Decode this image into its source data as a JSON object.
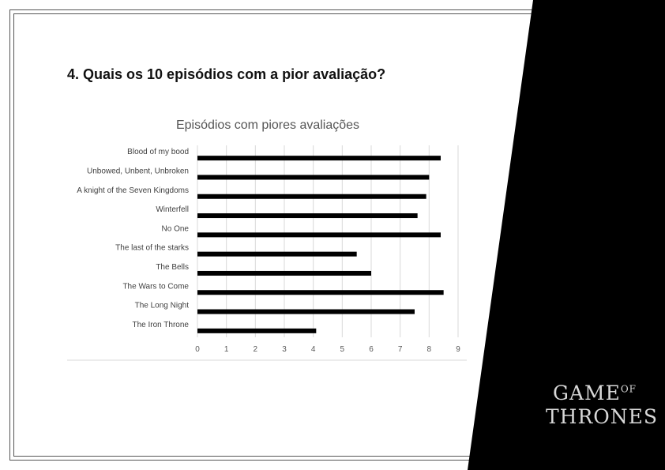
{
  "slide": {
    "heading": "4. Quais os 10 episódios com a pior avaliação?"
  },
  "logo": {
    "line1_main": "GAME",
    "line1_small": "OF",
    "line2": "THRONES"
  },
  "chart_data": {
    "type": "bar",
    "orientation": "horizontal",
    "title": "Episódios com piores avaliações",
    "categories": [
      "Blood of my bood",
      "Unbowed, Unbent, Unbroken",
      "A knight of the Seven Kingdoms",
      "Winterfell",
      "No One",
      "The last of the starks",
      "The Bells",
      "The Wars to Come",
      "The Long Night",
      "The Iron Throne"
    ],
    "values": [
      8.4,
      8.0,
      7.9,
      7.6,
      8.4,
      5.5,
      6.0,
      8.5,
      7.5,
      4.1
    ],
    "xlim": [
      0,
      9
    ],
    "xticks": [
      "0",
      "1",
      "2",
      "3",
      "4",
      "5",
      "6",
      "7",
      "8",
      "9"
    ],
    "xlabel": "",
    "ylabel": "",
    "grid": "vertical",
    "legend": "none",
    "bar_color": "#000000"
  }
}
